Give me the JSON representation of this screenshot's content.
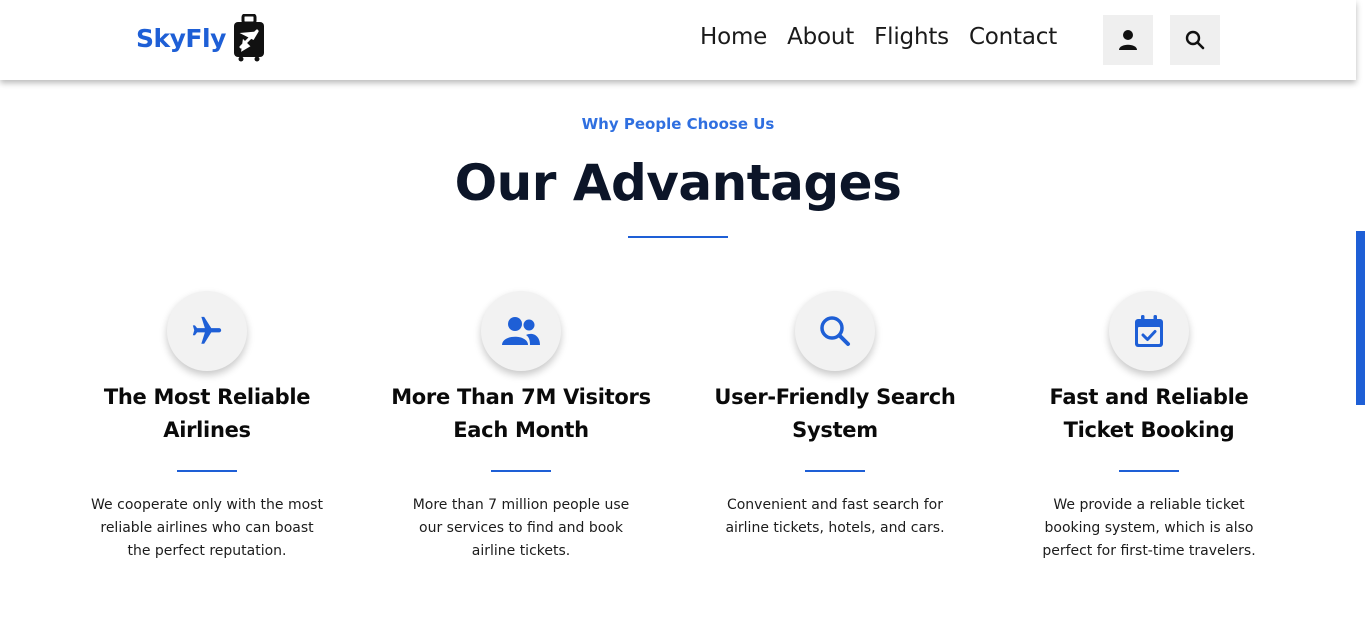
{
  "brand": {
    "name": "SkyFly",
    "logo_icon": "suitcase-plane-icon",
    "accent_color": "#1e5fd6"
  },
  "nav": {
    "links": [
      "Home",
      "About",
      "Flights",
      "Contact"
    ],
    "user_icon": "user-icon",
    "search_icon": "search-icon"
  },
  "section": {
    "eyebrow": "Why People Choose Us",
    "title": "Our Advantages"
  },
  "cards": [
    {
      "icon": "plane-icon",
      "title_line1": "The Most Reliable",
      "title_line2": "Airlines",
      "text_line1": "We cooperate only with the most",
      "text_line2": "reliable airlines who can boast",
      "text_line3": "the perfect reputation."
    },
    {
      "icon": "users-icon",
      "title_line1": "More Than 7M Visitors",
      "title_line2": "Each Month",
      "text_line1": "More than 7 million people use",
      "text_line2": "our services to find and book",
      "text_line3": "airline tickets."
    },
    {
      "icon": "search-icon",
      "title_line1": "User-Friendly Search",
      "title_line2": "System",
      "text_line1": "Convenient and fast search for",
      "text_line2": "airline tickets, hotels, and cars.",
      "text_line3": ""
    },
    {
      "icon": "calendar-check-icon",
      "title_line1": "Fast and Reliable",
      "title_line2": "Ticket Booking",
      "text_line1": "We provide a reliable ticket",
      "text_line2": "booking system, which is also",
      "text_line3": "perfect for first-time travelers."
    }
  ]
}
